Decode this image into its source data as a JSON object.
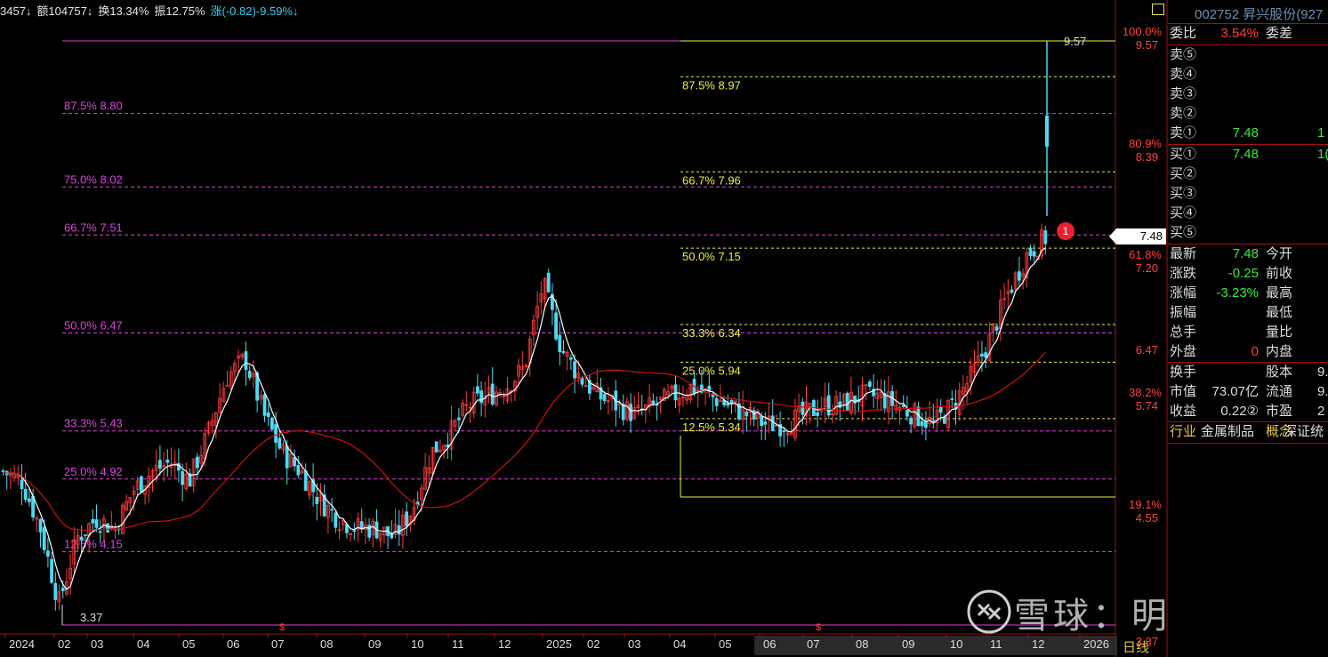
{
  "topbar": {
    "volume": "3457↓",
    "amount": "额104757↓",
    "turnover": "换13.34%",
    "amplitude": "振12.75%",
    "change": "涨(-0.82)-9.59%↓"
  },
  "panel": {
    "title": "002752 昇兴股份(927",
    "weibi_label": "委比",
    "weibi_value": "3.54%",
    "weicha_label": "委差",
    "sell_rows": [
      {
        "label": "卖⑤",
        "price": "",
        "vol": ""
      },
      {
        "label": "卖④",
        "price": "",
        "vol": ""
      },
      {
        "label": "卖③",
        "price": "",
        "vol": ""
      },
      {
        "label": "卖②",
        "price": "",
        "vol": ""
      },
      {
        "label": "卖①",
        "price": "7.48",
        "vol": "1"
      }
    ],
    "buy_rows": [
      {
        "label": "买①",
        "price": "7.48",
        "vol": "1("
      },
      {
        "label": "买②",
        "price": "",
        "vol": ""
      },
      {
        "label": "买③",
        "price": "",
        "vol": ""
      },
      {
        "label": "买④",
        "price": "",
        "vol": ""
      },
      {
        "label": "买⑤",
        "price": "",
        "vol": ""
      }
    ],
    "quote_rows": [
      {
        "l": "最新",
        "v": "7.48",
        "c": "#3ee83e",
        "l2": "今开",
        "v2": ""
      },
      {
        "l": "涨跌",
        "v": "-0.25",
        "c": "#3ee83e",
        "l2": "前收",
        "v2": ""
      },
      {
        "l": "涨幅",
        "v": "-3.23%",
        "c": "#3ee83e",
        "l2": "最高",
        "v2": ""
      },
      {
        "l": "振幅",
        "v": "",
        "c": "#ddd",
        "l2": "最低",
        "v2": ""
      },
      {
        "l": "总手",
        "v": "",
        "c": "#ddd",
        "l2": "量比",
        "v2": ""
      },
      {
        "l": "外盘",
        "v": "0",
        "c": "#ff4040",
        "l2": "内盘",
        "v2": ""
      }
    ],
    "fund_rows": [
      {
        "l": "换手",
        "v": "",
        "c": "#ddd",
        "l2": "股本",
        "v2": "9."
      },
      {
        "l": "市值",
        "v": "73.07亿",
        "c": "#ddd",
        "l2": "流通",
        "v2": "9."
      },
      {
        "l": "收益",
        "v": "0.22②",
        "c": "#ddd",
        "l2": "市盈",
        "v2": "2"
      }
    ],
    "industry_label": "行业",
    "industry_value": "金属制品",
    "concept_label": "概念",
    "concept_value": "深证统"
  },
  "price_tag": "7.48",
  "badge": "1",
  "day_label": "日线",
  "watermark": "雪球：明心观市",
  "right_axis": [
    {
      "pct": "100.0%",
      "price": "9.57"
    },
    {
      "pct": "80.9%",
      "price": "8.39"
    },
    {
      "pct": "61.8%",
      "price": "7.20"
    },
    {
      "pct": "",
      "price": "6.47"
    },
    {
      "pct": "38.2%",
      "price": "5.74"
    },
    {
      "pct": "19.1%",
      "price": "4.55"
    },
    {
      "pct": "",
      "price": "3.37"
    }
  ],
  "fib_left": [
    {
      "label": "87.5% 8.80"
    },
    {
      "label": "75.0% 8.02"
    },
    {
      "label": "66.7% 7.51"
    },
    {
      "label": "50.0% 6.47"
    },
    {
      "label": "33.3% 5.43"
    },
    {
      "label": "25.0% 4.92"
    },
    {
      "label": "12.5% 4.15"
    }
  ],
  "fib_right": [
    {
      "label": "87.5% 8.97"
    },
    {
      "label": "66.7% 7.96"
    },
    {
      "label": "50.0% 7.15"
    },
    {
      "label": "33.3% 6.34"
    },
    {
      "label": "25.0% 5.94"
    },
    {
      "label": "12.5% 5.34"
    }
  ],
  "low_label": "3.37",
  "high_label": "9.57",
  "x_axis": [
    "2024",
    "02",
    "03",
    "04",
    "05",
    "06",
    "07",
    "08",
    "09",
    "10",
    "11",
    "12",
    "2025",
    "02",
    "03",
    "04",
    "05",
    "06",
    "07",
    "08",
    "09",
    "10",
    "11",
    "12",
    "2026"
  ],
  "colors": {
    "up": "#ff3b3b",
    "down": "#4fd8f0",
    "ma_short": "#ffffff",
    "ma_long": "#d01010",
    "fib_left": "#e040e0",
    "fib_right": "#f0f040"
  },
  "chart_data": {
    "type": "candlestick",
    "ylim": [
      3.37,
      9.57
    ],
    "closes_approx": [
      5.0,
      4.9,
      4.4,
      3.6,
      4.3,
      4.5,
      4.4,
      4.8,
      5.0,
      5.1,
      4.9,
      5.4,
      6.0,
      6.2,
      5.6,
      5.2,
      5.0,
      4.7,
      4.5,
      4.4,
      4.4,
      4.3,
      4.6,
      5.2,
      5.4,
      5.7,
      5.8,
      5.9,
      6.1,
      7.0,
      6.3,
      6.0,
      5.8,
      5.7,
      5.6,
      5.7,
      5.8,
      5.9,
      5.8,
      5.7,
      5.6,
      5.5,
      5.5,
      5.6,
      5.7,
      5.7,
      5.8,
      5.8,
      5.7,
      5.6,
      5.5,
      5.7,
      6.0,
      6.4,
      6.9,
      7.3,
      7.48
    ]
  }
}
